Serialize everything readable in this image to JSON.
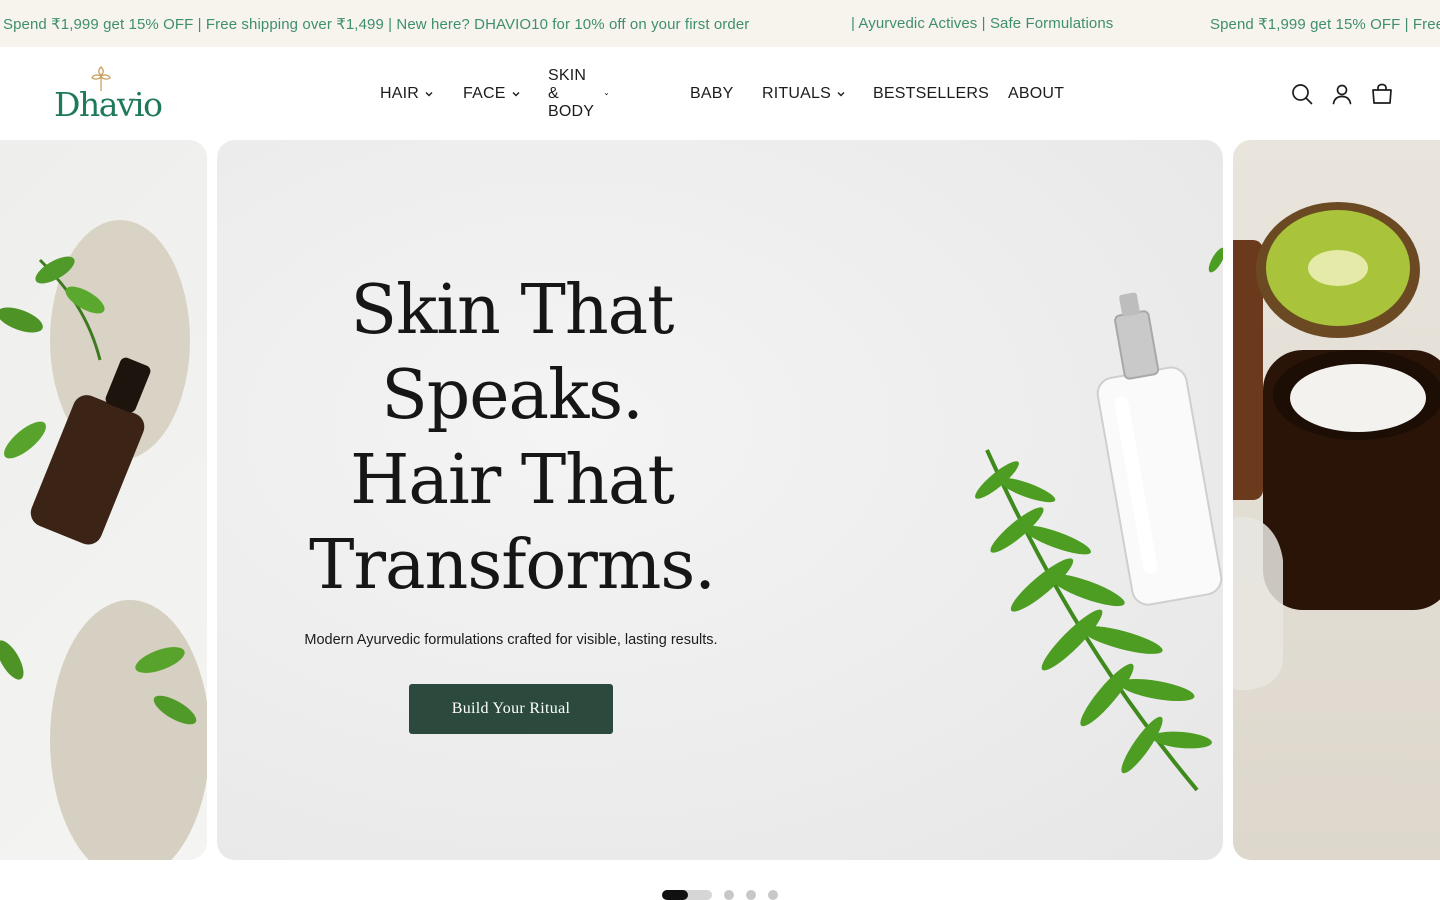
{
  "announcement": {
    "message_1": "Spend ₹1,999 get 15% OFF | Free shipping over ₹1,499 | New here? DHAVIO10 for 10% off on your first order",
    "message_2": "| Ayurvedic Actives | Safe Formulations",
    "message_3": "Spend ₹1,999 get 15% OFF | Free"
  },
  "header": {
    "logo_text": "Dhavio",
    "nav": [
      {
        "label": "HAIR",
        "has_dropdown": true
      },
      {
        "label": "FACE",
        "has_dropdown": true
      },
      {
        "label": "SKIN & BODY",
        "has_dropdown": true
      },
      {
        "label": "BABY",
        "has_dropdown": false
      },
      {
        "label": "RITUALS",
        "has_dropdown": true
      },
      {
        "label": "BESTSELLERS",
        "has_dropdown": false
      },
      {
        "label": "ABOUT",
        "has_dropdown": false
      }
    ],
    "icons": [
      "search-icon",
      "account-icon",
      "cart-icon"
    ]
  },
  "hero": {
    "title": "Skin That Speaks. Hair That Transforms.",
    "subtitle": "Modern Ayurvedic formulations crafted for visible, lasting results.",
    "cta_label": "Build Your Ritual"
  },
  "carousel": {
    "total_slides": 4,
    "active_index": 0
  },
  "colors": {
    "announcement_bg": "#f7f4ee",
    "announcement_text": "#3f8f6c",
    "brand_green": "#1f7a5c",
    "logo_gold": "#c9a063",
    "cta_bg": "#2b4a3d",
    "text": "#1c1c1c"
  }
}
